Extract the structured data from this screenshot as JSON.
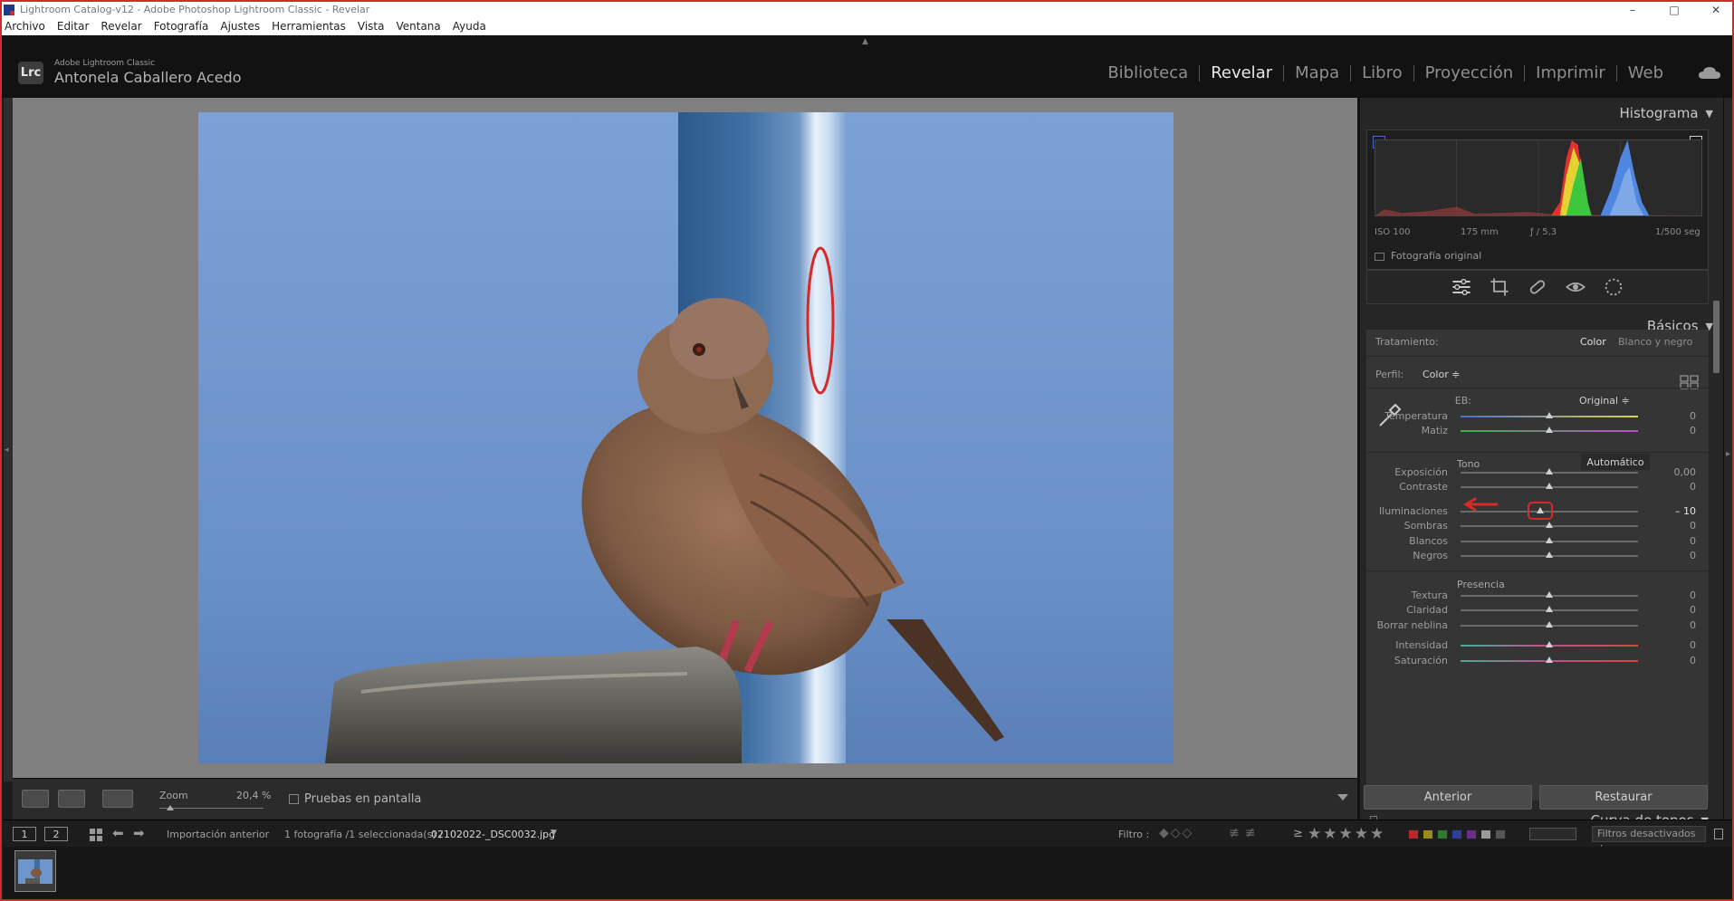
{
  "window": {
    "title": "Lightroom Catalog-v12 - Adobe Photoshop Lightroom Classic - Revelar",
    "minimize": "–",
    "maximize": "□",
    "close": "✕"
  },
  "menu": [
    "Archivo",
    "Editar",
    "Revelar",
    "Fotografía",
    "Ajustes",
    "Herramientas",
    "Vista",
    "Ventana",
    "Ayuda"
  ],
  "identity": {
    "logo": "Lrc",
    "product": "Adobe Lightroom Classic",
    "user": "Antonela Caballero Acedo"
  },
  "modules": [
    {
      "label": "Biblioteca",
      "active": false
    },
    {
      "label": "Revelar",
      "active": true
    },
    {
      "label": "Mapa",
      "active": false
    },
    {
      "label": "Libro",
      "active": false
    },
    {
      "label": "Proyección",
      "active": false
    },
    {
      "label": "Imprimir",
      "active": false
    },
    {
      "label": "Web",
      "active": false
    }
  ],
  "histogram": {
    "title": "Histograma",
    "iso": "ISO 100",
    "focal": "175 mm",
    "aperture": "ƒ / 5,3",
    "shutter": "1/500 seg",
    "original_label": "Fotografía original"
  },
  "tools": [
    "sliders-icon",
    "crop-icon",
    "healing-icon",
    "redeye-icon",
    "mask-icon"
  ],
  "basics": {
    "title": "Básicos",
    "treatment_label": "Tratamiento:",
    "treatment_color": "Color",
    "treatment_bw": "Blanco y negro",
    "profile_label": "Perfil:",
    "profile_value": "Color ≑",
    "wb_label": "EB:",
    "wb_value": "Original ≑",
    "tone_label": "Tono",
    "auto_label": "Automático",
    "presence_label": "Presencia"
  },
  "sliders": [
    {
      "label": "Temperatura",
      "value": "0",
      "pos": 0.5,
      "track": "temp"
    },
    {
      "label": "Matiz",
      "value": "0",
      "pos": 0.5,
      "track": "tint"
    },
    {
      "label": "Exposición",
      "value": "0,00",
      "pos": 0.5,
      "track": "gray"
    },
    {
      "label": "Contraste",
      "value": "0",
      "pos": 0.5,
      "track": "gray"
    },
    {
      "label": "Iluminaciones",
      "value": "– 10",
      "pos": 0.45,
      "track": "gray"
    },
    {
      "label": "Sombras",
      "value": "0",
      "pos": 0.5,
      "track": "gray"
    },
    {
      "label": "Blancos",
      "value": "0",
      "pos": 0.5,
      "track": "gray"
    },
    {
      "label": "Negros",
      "value": "0",
      "pos": 0.5,
      "track": "gray"
    },
    {
      "label": "Textura",
      "value": "0",
      "pos": 0.5,
      "track": "gray"
    },
    {
      "label": "Claridad",
      "value": "0",
      "pos": 0.5,
      "track": "gray"
    },
    {
      "label": "Borrar neblina",
      "value": "0",
      "pos": 0.5,
      "track": "gray"
    },
    {
      "label": "Intensidad",
      "value": "0",
      "pos": 0.5,
      "track": "vib"
    },
    {
      "label": "Saturación",
      "value": "0",
      "pos": 0.5,
      "track": "vib"
    }
  ],
  "tone_curve": {
    "title": "Curva de tonos"
  },
  "buttons": {
    "previous": "Anterior",
    "reset": "Restaurar"
  },
  "toolbar": {
    "zoom_label": "Zoom",
    "zoom_value": "20,4 %",
    "zoom_level": 0.1,
    "proof_label": "Pruebas en pantalla"
  },
  "filmstrip_bar": {
    "screen1": "1",
    "screen2": "2",
    "source": "Importación anterior",
    "count": "1 fotografía /1 seleccionada(s) /",
    "filename": "02102022-_DSC0032.jpg",
    "filter_label": "Filtro :",
    "rating_op": "≥",
    "stars": "★★★★★",
    "filters_off": "Filtros desactivados ≑"
  },
  "colors": {
    "accent_red": "#d42a2a",
    "sky": "#6f96cc",
    "label_red": "#b52a2a",
    "label_yellow": "#9a8a1e",
    "label_green": "#2f7a2f",
    "label_blue": "#2e3f9a",
    "label_purple": "#6a2e8a"
  }
}
